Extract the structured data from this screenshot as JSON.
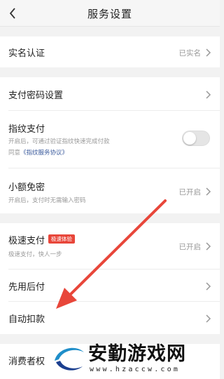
{
  "header": {
    "title": "服务设置"
  },
  "rows": {
    "real_name": {
      "label": "实名认证",
      "value": "已实名"
    },
    "pay_password": {
      "label": "支付密码设置"
    },
    "fingerprint": {
      "label": "指纹支付",
      "sub1": "开启后，可通过验证指纹快速完成付款",
      "sub2_prefix": "同意",
      "sub2_link": "《指纹服务协议》",
      "enabled": false
    },
    "small_free": {
      "label": "小额免密",
      "value": "已开启",
      "sub": "开启后，支付时无需输入密码"
    },
    "fast_pay": {
      "label": "极速支付",
      "badge": "极速体验",
      "value": "已开启",
      "sub": "极速支付，快人一步"
    },
    "pay_later": {
      "label": "先用后付"
    },
    "auto_deduct": {
      "label": "自动扣款"
    },
    "consumer": {
      "label": "消费者权"
    }
  },
  "watermark": {
    "title": "安勤游戏网",
    "url": "www.hzaccw.com"
  },
  "colors": {
    "annotation_arrow": "#e8463a",
    "badge": "#e8463a",
    "link": "#3a5a9c"
  }
}
